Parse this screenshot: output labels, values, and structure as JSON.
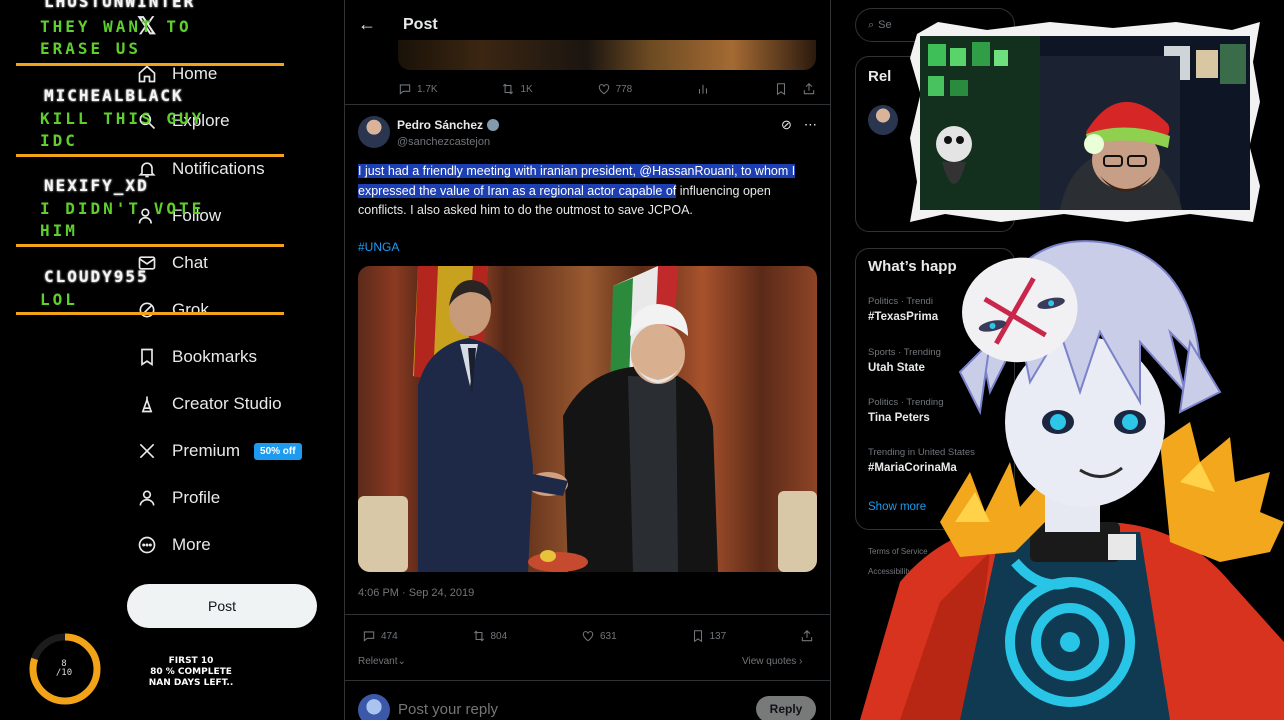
{
  "chat_overlay": {
    "entries": [
      {
        "user": "LHUSTUNWINTER",
        "message": "THEY WANT TO ERASE US"
      },
      {
        "user": "MICHEALBLACK",
        "message": "KILL THIS GUY IDC"
      },
      {
        "user": "NEXIFY_XD",
        "message": "I DIDN'T VOTE HIM"
      },
      {
        "user": "CLOUDY955",
        "message": "LOL"
      }
    ]
  },
  "goal_widget": {
    "count_current": "8",
    "count_total": "/10",
    "line1": "FIRST 10",
    "line2": "80 % COMPLETE",
    "line3": "NAN DAYS LEFT..",
    "progress_fraction": 0.8,
    "ring_color": "#f3a318"
  },
  "sidebar": {
    "items": [
      {
        "label": "Home",
        "icon": "home-icon"
      },
      {
        "label": "Explore",
        "icon": "search-icon"
      },
      {
        "label": "Notifications",
        "icon": "bell-icon"
      },
      {
        "label": "Follow",
        "icon": "follow-icon"
      },
      {
        "label": "Chat",
        "icon": "mail-icon"
      },
      {
        "label": "Grok",
        "icon": "grok-icon"
      },
      {
        "label": "Bookmarks",
        "icon": "bookmark-icon"
      },
      {
        "label": "Creator Studio",
        "icon": "creator-studio-icon"
      },
      {
        "label": "Premium",
        "icon": "x-premium-icon",
        "badge": "50% off"
      },
      {
        "label": "Profile",
        "icon": "profile-icon"
      },
      {
        "label": "More",
        "icon": "more-icon"
      }
    ],
    "post_button": "Post"
  },
  "header": {
    "title": "Post"
  },
  "previous_post": {
    "replies": "1.7K",
    "reposts": "1K",
    "likes": "778"
  },
  "tweet": {
    "author": "Pedro Sánchez",
    "handle": "@sanchezcastejon",
    "text_highlighted": "I just had a friendly meeting with iranian president, @HassanRouani, to whom I expressed the value of Iran as a regional actor capable of",
    "text_rest": " influencing open conflicts. I also asked him to do the outmost to save JCPOA.",
    "hashtag": "#UNGA",
    "timestamp": "4:06 PM · Sep 24, 2019",
    "replies": "474",
    "reposts": "804",
    "likes": "631",
    "bookmarks": "137",
    "sort_label": "Relevant",
    "view_quotes": "View quotes"
  },
  "reply_box": {
    "placeholder": "Post your reply",
    "button": "Reply"
  },
  "right_sidebar": {
    "search_placeholder": "Se",
    "relevant_title": "Rel",
    "happening_title": "What’s happ",
    "trends": [
      {
        "meta": "Politics · Trendi",
        "name": "#TexasPrima"
      },
      {
        "meta": "Sports · Trending",
        "name": "Utah State"
      },
      {
        "meta": "Politics · Trending",
        "name": "Tina Peters"
      },
      {
        "meta": "Trending in United States",
        "name": "#MariaCorinaMa"
      }
    ],
    "show_more": "Show more",
    "footer": [
      "Terms of Service",
      "Accessibility"
    ]
  },
  "colors": {
    "accent": "#1d9bf0",
    "chat_separator": "#f3a318",
    "chat_message": "#5ecf2c",
    "highlight": "#1d3fb4"
  }
}
